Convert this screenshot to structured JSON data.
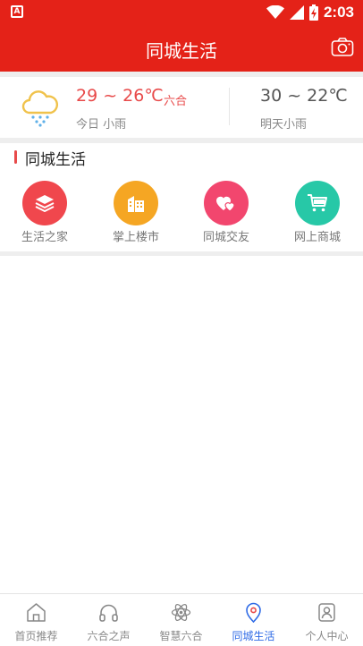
{
  "status_bar": {
    "time": "2:03",
    "left_icon": "a-notification-icon"
  },
  "header": {
    "title": "同城生活",
    "camera_icon": "camera-icon"
  },
  "weather": {
    "today_temp": "29 ~ 26℃",
    "location": "六合",
    "today_desc": "今日 小雨",
    "tomorrow_temp": "30 ~ 22℃",
    "tomorrow_desc": "明天小雨",
    "icon": "cloud-rain-icon"
  },
  "section": {
    "title": "同城生活"
  },
  "services": [
    {
      "label": "生活之家",
      "icon": "layers-icon",
      "color": "#f0474d"
    },
    {
      "label": "掌上楼市",
      "icon": "building-icon",
      "color": "#f5a623"
    },
    {
      "label": "同城交友",
      "icon": "hearts-icon",
      "color": "#f2466e"
    },
    {
      "label": "网上商城",
      "icon": "cart-icon",
      "color": "#27c8a7"
    }
  ],
  "bottom_nav": [
    {
      "label": "首页推荐",
      "icon": "home-icon",
      "active": false
    },
    {
      "label": "六合之声",
      "icon": "headphones-icon",
      "active": false
    },
    {
      "label": "智慧六合",
      "icon": "atom-icon",
      "active": false
    },
    {
      "label": "同城生活",
      "icon": "location-pin-icon",
      "active": true
    },
    {
      "label": "个人中心",
      "icon": "user-icon",
      "active": false
    }
  ],
  "colors": {
    "primary_red": "#e42218",
    "active_blue": "#2f6be6",
    "temp_red": "#e84a4a"
  }
}
